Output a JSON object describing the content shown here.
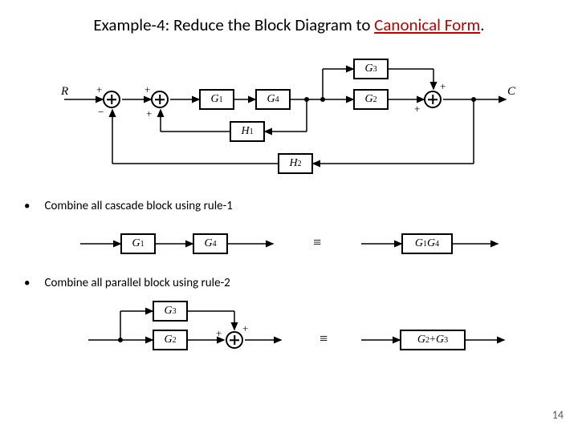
{
  "title_prefix": "Example-4: Reduce the Block Diagram to ",
  "title_highlight": "Canonical Form",
  "title_suffix": ".",
  "bullet1": "Combine all cascade block using rule-1",
  "bullet2": "Combine all parallel block using rule-2",
  "page_number": "14",
  "labels": {
    "R": "R",
    "C": "C",
    "G1": "G",
    "G1s": "1",
    "G2": "G",
    "G2s": "2",
    "G3": "G",
    "G3s": "3",
    "G4": "G",
    "G4s": "4",
    "H1": "H",
    "H1s": "1",
    "H2": "H",
    "H2s": "2",
    "G1G4": "G",
    "G1G4a": "1",
    "G1G4b": "G",
    "G1G4c": "4",
    "G2G3": "G",
    "G2G3a": "2",
    "G2G3p": " + ",
    "G2G3b": "G",
    "G2G3c": "3",
    "equiv": "≡",
    "plus": "+",
    "minus": "−"
  },
  "chart_data": {
    "type": "block-diagram",
    "title": "Block diagram reduction to canonical form",
    "input": "R",
    "output": "C",
    "blocks": [
      "G1",
      "G2",
      "G3",
      "G4",
      "H1",
      "H2"
    ],
    "summing_junctions": [
      {
        "id": "S1",
        "inputs": [
          {
            "from": "R",
            "sign": "+"
          },
          {
            "from": "feedback_H2_via_C",
            "sign": "-"
          }
        ]
      },
      {
        "id": "S2",
        "inputs": [
          {
            "from": "S1",
            "sign": "+"
          },
          {
            "from": "H1_output",
            "sign": "+"
          }
        ]
      },
      {
        "id": "S3",
        "inputs": [
          {
            "from": "G3",
            "sign": "+"
          },
          {
            "from": "G2",
            "sign": "+"
          }
        ]
      }
    ],
    "forward_path": [
      "S1",
      "S2",
      "G1",
      "G4",
      [
        "parallel",
        "G3",
        "G2"
      ],
      "S3",
      "C"
    ],
    "feedback_paths": [
      {
        "from": "after_G4",
        "through": "H1",
        "to": "S2",
        "sign": "+"
      },
      {
        "from": "C",
        "through": "H2",
        "to": "S1",
        "sign": "-"
      }
    ],
    "reductions": [
      {
        "rule": 1,
        "description": "cascade",
        "before": [
          "G1",
          "G4"
        ],
        "after": "G1*G4"
      },
      {
        "rule": 2,
        "description": "parallel",
        "before": [
          "G3",
          "G2"
        ],
        "after": "G2 + G3"
      }
    ]
  }
}
